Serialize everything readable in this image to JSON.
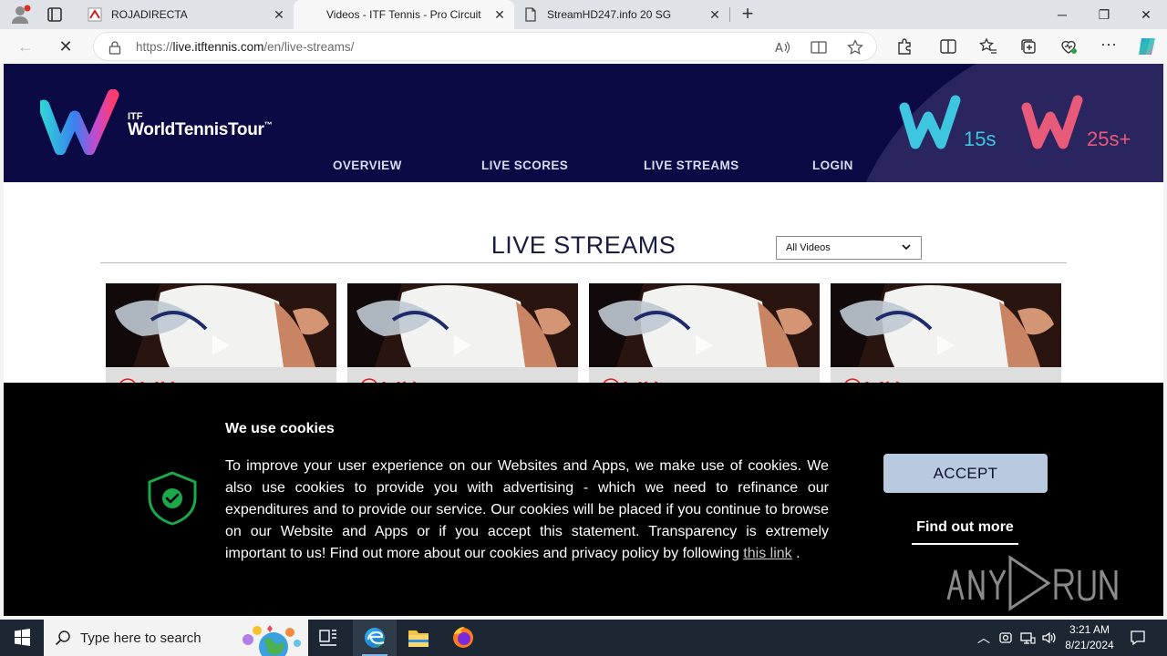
{
  "browser": {
    "tabs": [
      {
        "title": "ROJADIRECTA",
        "active": false
      },
      {
        "title": "Videos - ITF Tennis - Pro Circuit",
        "active": true
      },
      {
        "title": "StreamHD247.info 20 SG",
        "active": false
      }
    ],
    "url_prefix": "https://",
    "url_domain": "live.itftennis.com",
    "url_path": "/en/live-streams/"
  },
  "site": {
    "logo_itf": "ITF",
    "logo_text": "WorldTennisTour",
    "logo_tm": "™",
    "nav": [
      "OVERVIEW",
      "LIVE SCORES",
      "LIVE STREAMS",
      "LOGIN"
    ],
    "badges": [
      {
        "label": "15s",
        "color": "#3ec6e0"
      },
      {
        "label": "25s+",
        "color": "#e85a7a"
      }
    ]
  },
  "main": {
    "title": "LIVE STREAMS",
    "filter_selected": "All Videos",
    "cards": [
      {
        "id": 1
      },
      {
        "id": 2
      },
      {
        "id": 3
      },
      {
        "id": 4
      }
    ]
  },
  "cookie": {
    "title": "We use cookies",
    "body": "To improve your user experience on our Websites and Apps, we make use of cookies. We also use cookies to provide you with advertising - which we need to refinance our expenditures and to provide our service. Our cookies will be placed if you continue to browse on our Website and Apps or if you accept this statement. Transparency is extremely important to us! Find out more about our cookies and privacy policy by following",
    "link_text": "this link",
    "body_end": ".",
    "accept_label": "ACCEPT",
    "find_out_label": "Find out more"
  },
  "taskbar": {
    "search_placeholder": "Type here to search",
    "time": "3:21 AM",
    "date": "8/21/2024"
  },
  "colors": {
    "header_bg": "#0c0a45",
    "accept_bg": "#b9c9df",
    "shield_green": "#1aa84a"
  }
}
